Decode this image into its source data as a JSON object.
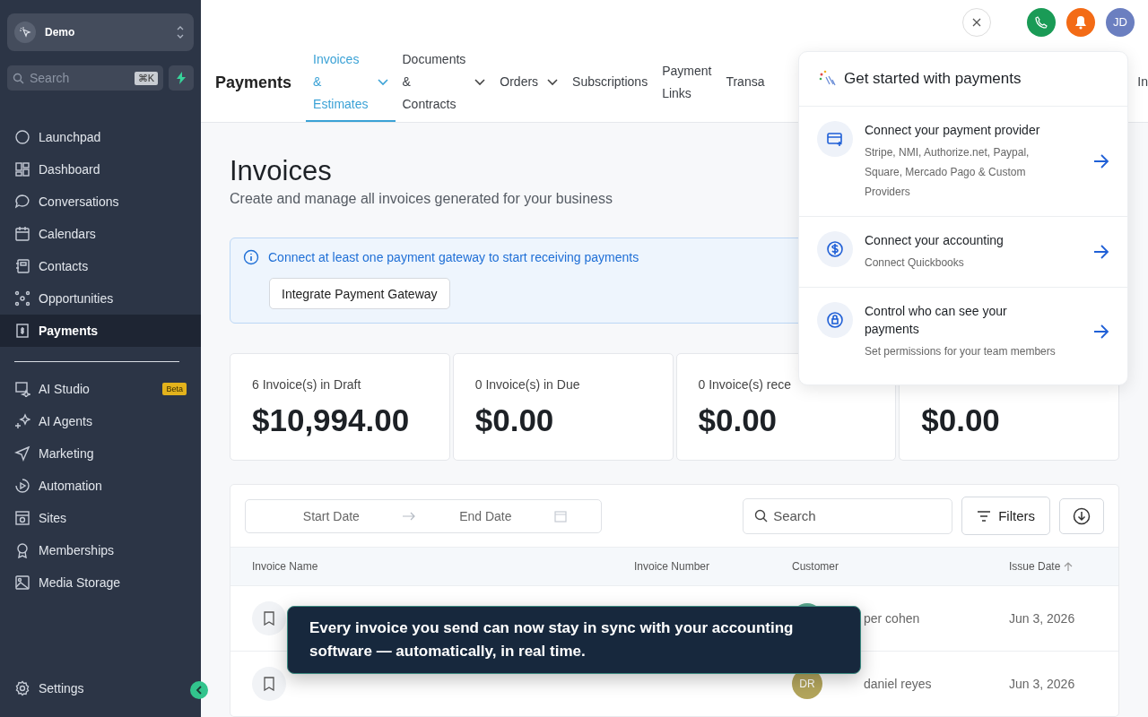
{
  "sidebar": {
    "account": {
      "name": "Demo"
    },
    "search": {
      "placeholder": "Search",
      "shortcut": "⌘K"
    },
    "items": [
      {
        "label": "Launchpad",
        "selected": false
      },
      {
        "label": "Dashboard",
        "selected": false
      },
      {
        "label": "Conversations",
        "selected": false
      },
      {
        "label": "Calendars",
        "selected": false
      },
      {
        "label": "Contacts",
        "selected": false
      },
      {
        "label": "Opportunities",
        "selected": false
      },
      {
        "label": "Payments",
        "selected": true
      }
    ],
    "items_2": [
      {
        "label": "AI Studio",
        "selected": false,
        "badge": "Beta"
      },
      {
        "label": "AI Agents",
        "selected": false
      },
      {
        "label": "Marketing",
        "selected": false
      },
      {
        "label": "Automation",
        "selected": false
      },
      {
        "label": "Sites",
        "selected": false
      },
      {
        "label": "Memberships",
        "selected": false
      },
      {
        "label": "Media Storage",
        "selected": false
      }
    ],
    "settings": "Settings"
  },
  "top_bar": {
    "avatar_initials": "JD"
  },
  "nav": {
    "title": "Payments",
    "tabs": [
      {
        "label": "Invoices & Estimates",
        "selected": true,
        "dropdown": true
      },
      {
        "label": "Documents & Contracts",
        "selected": false,
        "dropdown": true
      },
      {
        "label": "Orders",
        "selected": false,
        "dropdown": true
      },
      {
        "label": "Subscriptions",
        "selected": false,
        "dropdown": false
      },
      {
        "label": "Payment Links",
        "selected": false,
        "dropdown": false
      },
      {
        "label": "Transa",
        "selected": false,
        "dropdown": false
      },
      {
        "label": "In",
        "selected": false,
        "dropdown": false
      }
    ]
  },
  "page": {
    "title": "Invoices",
    "subtitle": "Create and manage all invoices generated for your business"
  },
  "alert": {
    "message": "Connect at least one payment gateway to start receiving payments",
    "button": "Integrate Payment Gateway"
  },
  "stats": [
    {
      "label": "6 Invoice(s) in Draft",
      "amount": "$10,994.00"
    },
    {
      "label": "0 Invoice(s) in Due",
      "amount": "$0.00"
    },
    {
      "label": "0 Invoice(s) rece",
      "amount": "$0.00"
    },
    {
      "amount": "$0.00"
    }
  ],
  "toolbar": {
    "start_date": "Start Date",
    "end_date": "End Date",
    "search_placeholder": "Search",
    "filters": "Filters"
  },
  "table": {
    "columns": [
      {
        "label": "Invoice Name",
        "sorted": false
      },
      {
        "label": "Invoice Number",
        "sorted": false
      },
      {
        "label": "Customer",
        "sorted": false
      },
      {
        "label": "Issue Date",
        "sorted": true
      }
    ],
    "rows": [
      {
        "customer": "per cohen",
        "color": "#5aa88e",
        "date": "Jun 3, 2026"
      },
      {
        "customer": "daniel reyes",
        "initials": "DR",
        "color": "#b3a55c",
        "date": "Jun 3, 2026"
      }
    ]
  },
  "setup_panel": {
    "title": "Get started with payments",
    "steps": [
      {
        "title": "Connect your payment provider",
        "description": "Stripe, NMI, Authorize.net, Paypal, Square, Mercado Pago & Custom Providers"
      },
      {
        "title": "Connect your accounting",
        "description": "Connect Quickbooks"
      },
      {
        "title": "Control who can see your payments",
        "description": "Set permissions for your team members"
      }
    ]
  },
  "toast": {
    "message": "Every invoice you send can now stay in sync with your accounting software — automatically, in real time."
  }
}
